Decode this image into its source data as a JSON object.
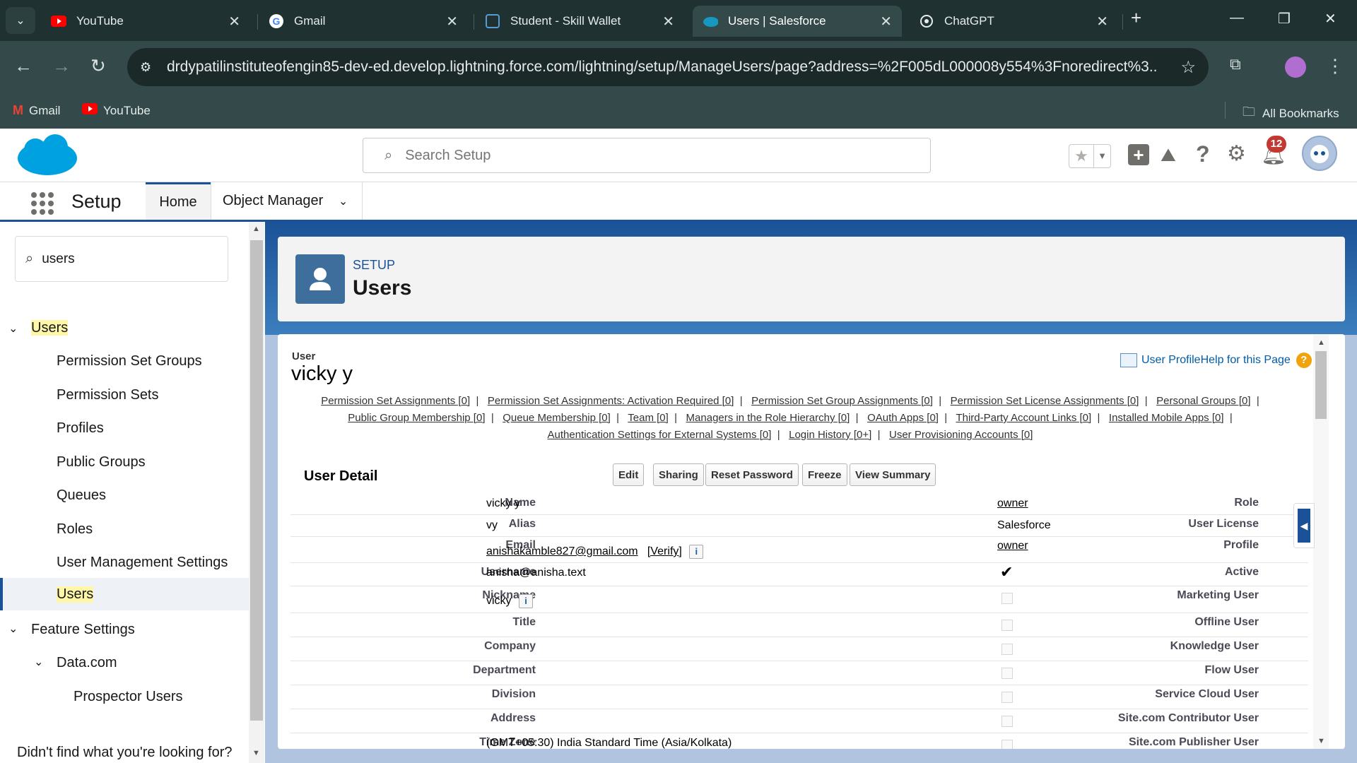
{
  "browser": {
    "tabs": [
      {
        "label": "YouTube",
        "icon": "youtube-icon",
        "active": false
      },
      {
        "label": "Gmail",
        "icon": "google-icon",
        "active": false
      },
      {
        "label": "Student - Skill Wallet",
        "icon": "skill-wallet-icon",
        "active": false
      },
      {
        "label": "Users | Salesforce",
        "icon": "salesforce-icon",
        "active": true
      },
      {
        "label": "ChatGPT",
        "icon": "chatgpt-icon",
        "active": false
      }
    ],
    "url": "drdypatilinstituteofengin85-dev-ed.develop.lightning.force.com/lightning/setup/ManageUsers/page?address=%2F005dL000008y554%3Fnoredirect%3...",
    "bookmarks": [
      {
        "label": "Gmail",
        "icon": "gmail-icon"
      },
      {
        "label": "YouTube",
        "icon": "youtube-icon"
      }
    ],
    "all_bookmarks": "All Bookmarks"
  },
  "header": {
    "search_placeholder": "Search Setup",
    "notification_count": "12"
  },
  "nav": {
    "app_name": "Setup",
    "tabs": [
      {
        "label": "Home"
      },
      {
        "label": "Object Manager"
      }
    ]
  },
  "sidebar": {
    "quickfind_value": "users",
    "items": [
      {
        "label": "Users",
        "level": 0,
        "expanded": true
      },
      {
        "label": "Permission Set Groups",
        "level": 1
      },
      {
        "label": "Permission Sets",
        "level": 1
      },
      {
        "label": "Profiles",
        "level": 1
      },
      {
        "label": "Public Groups",
        "level": 1
      },
      {
        "label": "Queues",
        "level": 1
      },
      {
        "label": "Roles",
        "level": 1
      },
      {
        "label": "User Management Settings",
        "level": 1
      },
      {
        "label": "Users",
        "level": 1,
        "selected": true
      },
      {
        "label": "Feature Settings",
        "level": 0,
        "expanded": true
      },
      {
        "label": "Data.com",
        "level": 1,
        "expanded": true
      },
      {
        "label": "Prospector Users",
        "level": 2
      }
    ],
    "footer": "Didn't find what you're looking for?"
  },
  "page_header": {
    "eyebrow": "SETUP",
    "title": "Users"
  },
  "detail": {
    "object_label": "User",
    "record_name": "vicky y",
    "profile_link": "User Profile",
    "help_link": "Help for this Page",
    "related_links": [
      "Permission Set Assignments [0]",
      "Permission Set Assignments: Activation Required [0]",
      "Permission Set Group Assignments [0]",
      "Permission Set License Assignments [0]",
      "Personal Groups [0]",
      "Public Group Membership [0]",
      "Queue Membership [0]",
      "Team [0]",
      "Managers in the Role Hierarchy [0]",
      "OAuth Apps [0]",
      "Third-Party Account Links [0]",
      "Installed Mobile Apps [0]",
      "Authentication Settings for External Systems [0]",
      "Login History [0+]",
      "User Provisioning Accounts [0]"
    ],
    "section_title": "User Detail",
    "buttons": [
      "Edit",
      "Sharing",
      "Reset Password",
      "Freeze",
      "View Summary"
    ],
    "fields_left": [
      {
        "label": "Name",
        "value": "vicky y"
      },
      {
        "label": "Alias",
        "value": "vy"
      },
      {
        "label": "Email",
        "value": "anishakamble827@gmail.com",
        "extra": "[Verify]"
      },
      {
        "label": "Username",
        "value": "anisha@anisha.text"
      },
      {
        "label": "Nickname",
        "value": "vicky"
      },
      {
        "label": "Title",
        "value": ""
      },
      {
        "label": "Company",
        "value": ""
      },
      {
        "label": "Department",
        "value": ""
      },
      {
        "label": "Division",
        "value": ""
      },
      {
        "label": "Address",
        "value": ""
      },
      {
        "label": "Time Zone",
        "value": "(GMT+05:30) India Standard Time (Asia/Kolkata)"
      }
    ],
    "fields_right": [
      {
        "label": "Role",
        "value": "owner",
        "type": "link"
      },
      {
        "label": "User License",
        "value": "Salesforce",
        "type": "text"
      },
      {
        "label": "Profile",
        "value": "owner",
        "type": "link"
      },
      {
        "label": "Active",
        "checked": true,
        "type": "checkbox"
      },
      {
        "label": "Marketing User",
        "checked": false,
        "type": "checkbox"
      },
      {
        "label": "Offline User",
        "checked": false,
        "type": "checkbox"
      },
      {
        "label": "Knowledge User",
        "checked": false,
        "type": "checkbox"
      },
      {
        "label": "Flow User",
        "checked": false,
        "type": "checkbox"
      },
      {
        "label": "Service Cloud User",
        "checked": false,
        "type": "checkbox"
      },
      {
        "label": "Site.com Contributor User",
        "checked": false,
        "type": "checkbox"
      },
      {
        "label": "Site.com Publisher User",
        "checked": false,
        "type": "checkbox"
      }
    ]
  }
}
